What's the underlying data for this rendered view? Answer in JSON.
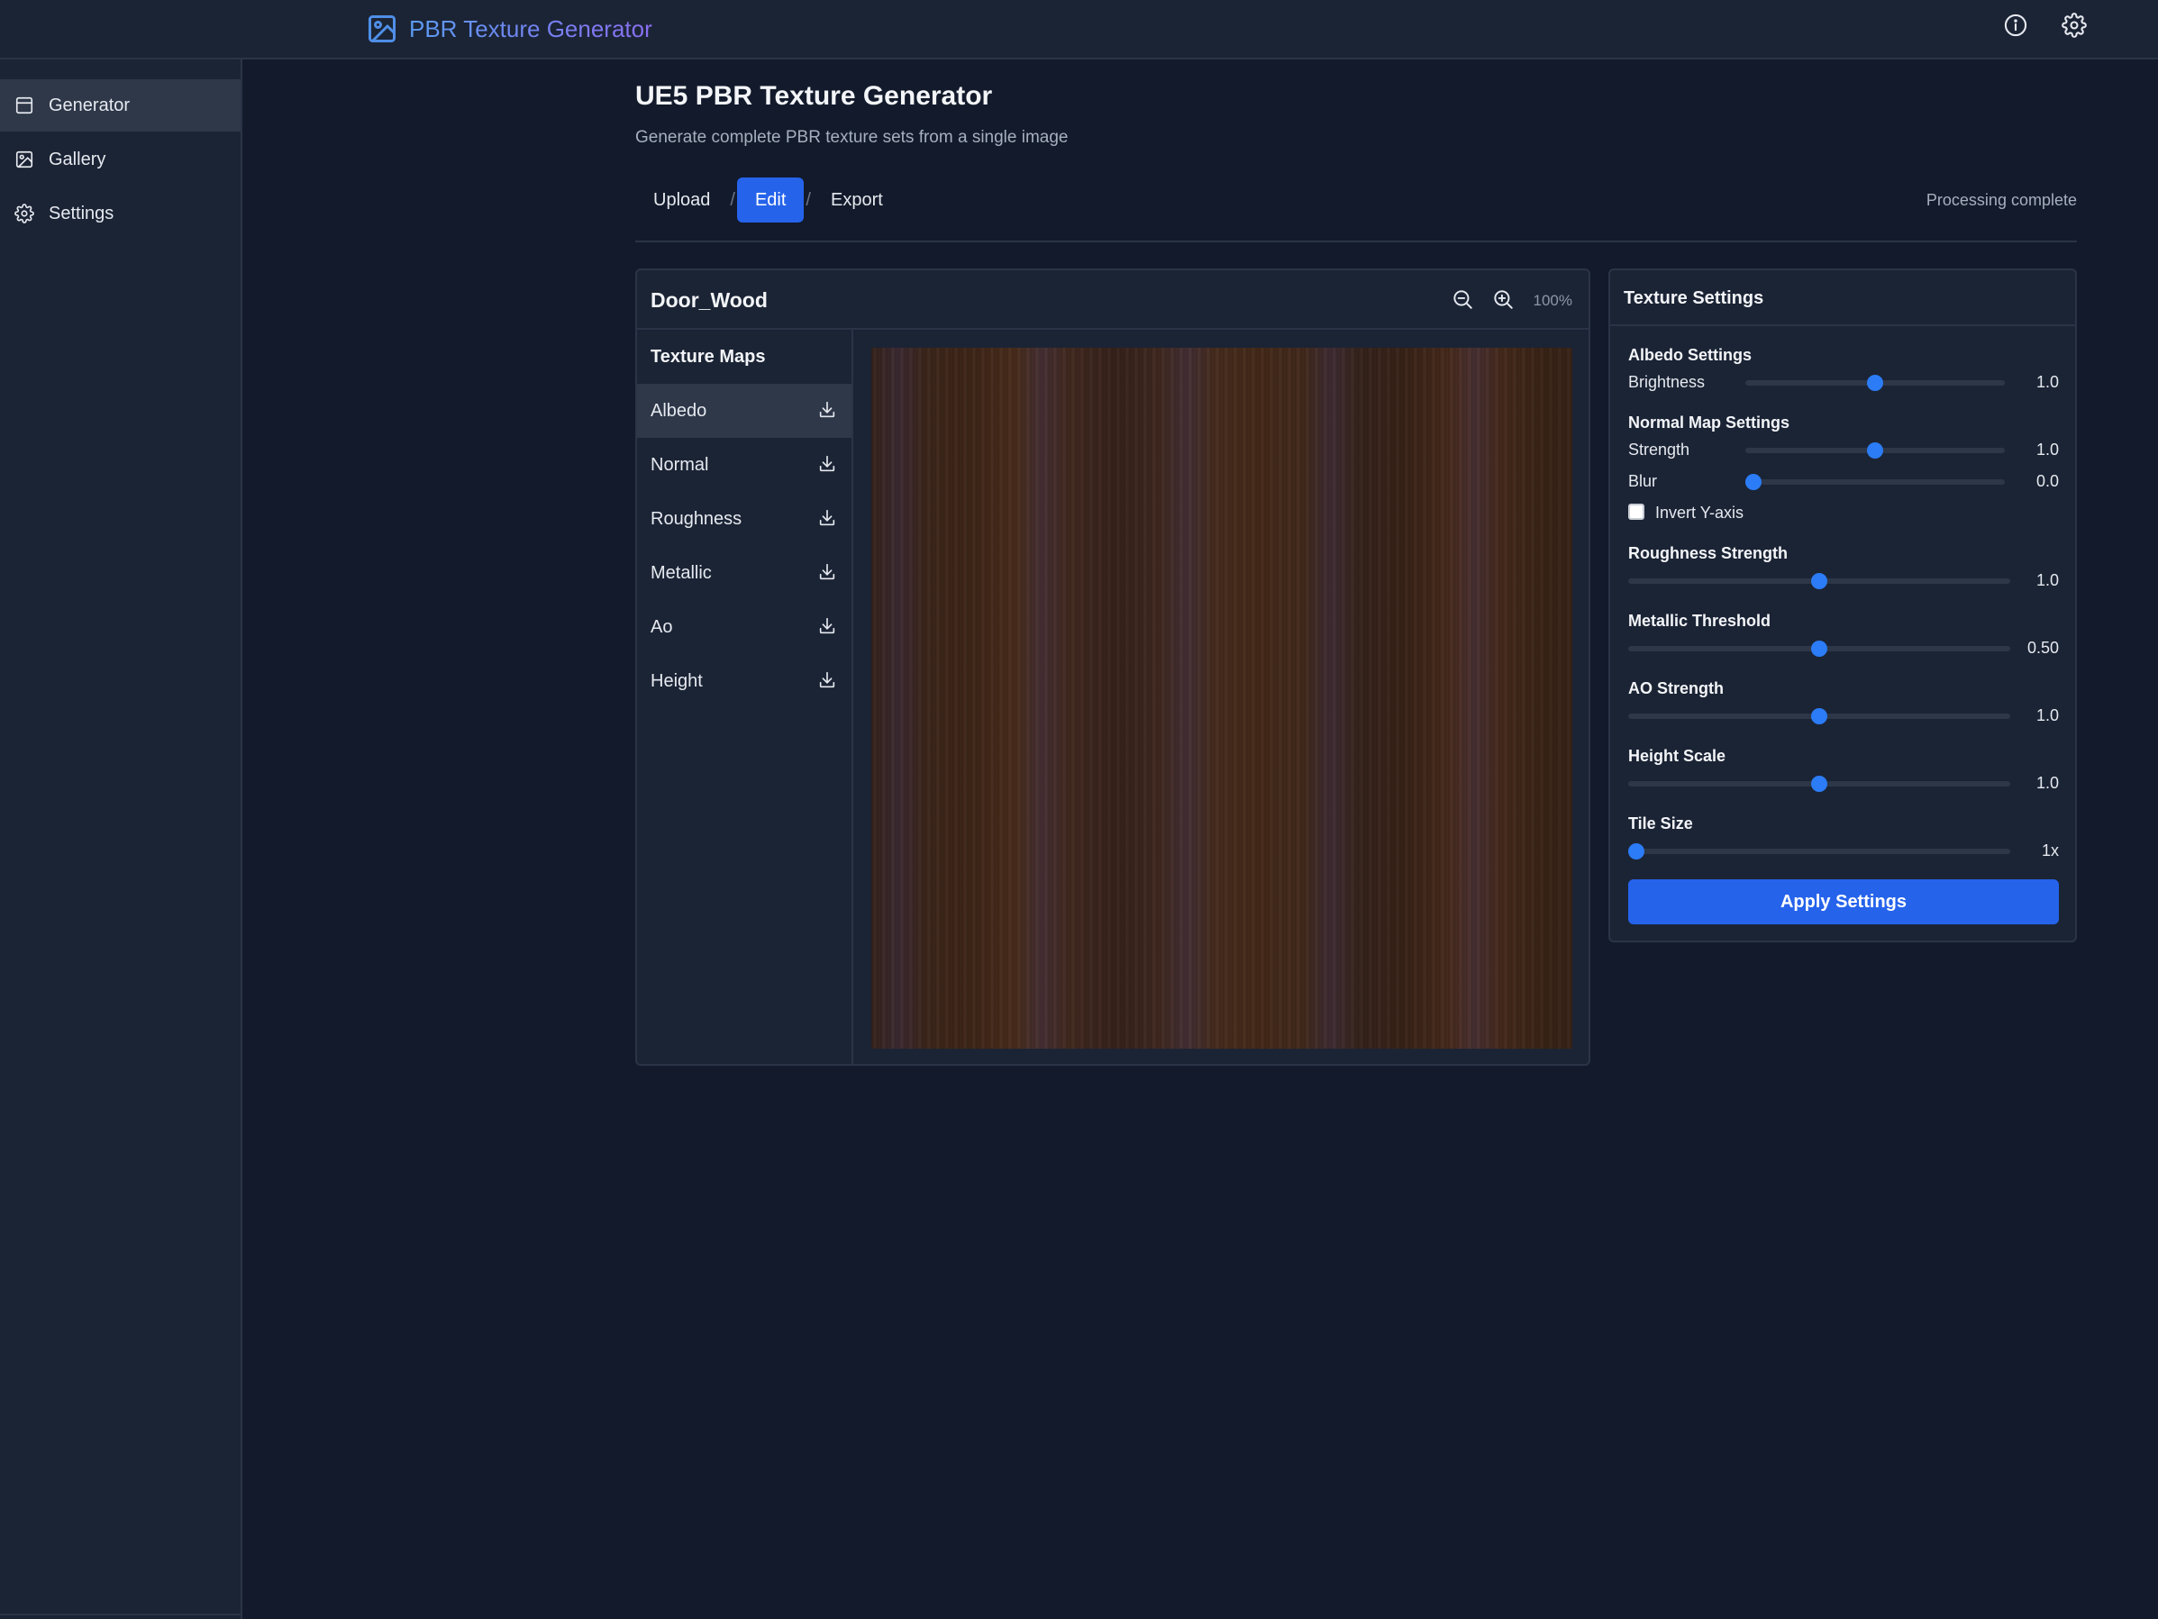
{
  "app": {
    "title": "PBR Texture Generator",
    "accent": "#2563eb"
  },
  "header": {
    "info_icon": "info-icon",
    "settings_icon": "gear-icon"
  },
  "sidebar": {
    "items": [
      {
        "label": "Generator",
        "icon": "layout-icon",
        "active": true
      },
      {
        "label": "Gallery",
        "icon": "image-icon",
        "active": false
      },
      {
        "label": "Settings",
        "icon": "gear-icon",
        "active": false
      }
    ]
  },
  "main": {
    "title": "UE5 PBR Texture Generator",
    "subtitle": "Generate complete PBR texture sets from a single image",
    "steps": [
      {
        "label": "Upload",
        "active": false
      },
      {
        "label": "Edit",
        "active": true
      },
      {
        "label": "Export",
        "active": false
      }
    ],
    "step_separator": "/",
    "status": "Processing complete"
  },
  "viewer": {
    "name": "Door_Wood",
    "zoom": "100%",
    "maps_heading": "Texture Maps",
    "maps": [
      {
        "label": "Albedo",
        "active": true
      },
      {
        "label": "Normal",
        "active": false
      },
      {
        "label": "Roughness",
        "active": false
      },
      {
        "label": "Metallic",
        "active": false
      },
      {
        "label": "Ao",
        "active": false
      },
      {
        "label": "Height",
        "active": false
      }
    ]
  },
  "settings": {
    "title": "Texture Settings",
    "albedo": {
      "heading": "Albedo Settings",
      "brightness": {
        "label": "Brightness",
        "value": "1.0",
        "fraction": 0.5
      }
    },
    "normal": {
      "heading": "Normal Map Settings",
      "strength": {
        "label": "Strength",
        "value": "1.0",
        "fraction": 0.5
      },
      "blur": {
        "label": "Blur",
        "value": "0.0",
        "fraction": 0.0
      },
      "invert_y": {
        "label": "Invert Y-axis",
        "checked": false
      }
    },
    "roughness": {
      "heading": "Roughness Strength",
      "value": "1.0",
      "fraction": 0.5
    },
    "metallic": {
      "heading": "Metallic Threshold",
      "value": "0.50",
      "fraction": 0.5
    },
    "ao": {
      "heading": "AO Strength",
      "value": "1.0",
      "fraction": 0.5
    },
    "height": {
      "heading": "Height Scale",
      "value": "1.0",
      "fraction": 0.5
    },
    "tile": {
      "heading": "Tile Size",
      "value": "1x",
      "fraction": 0.0
    },
    "apply_label": "Apply Settings"
  }
}
